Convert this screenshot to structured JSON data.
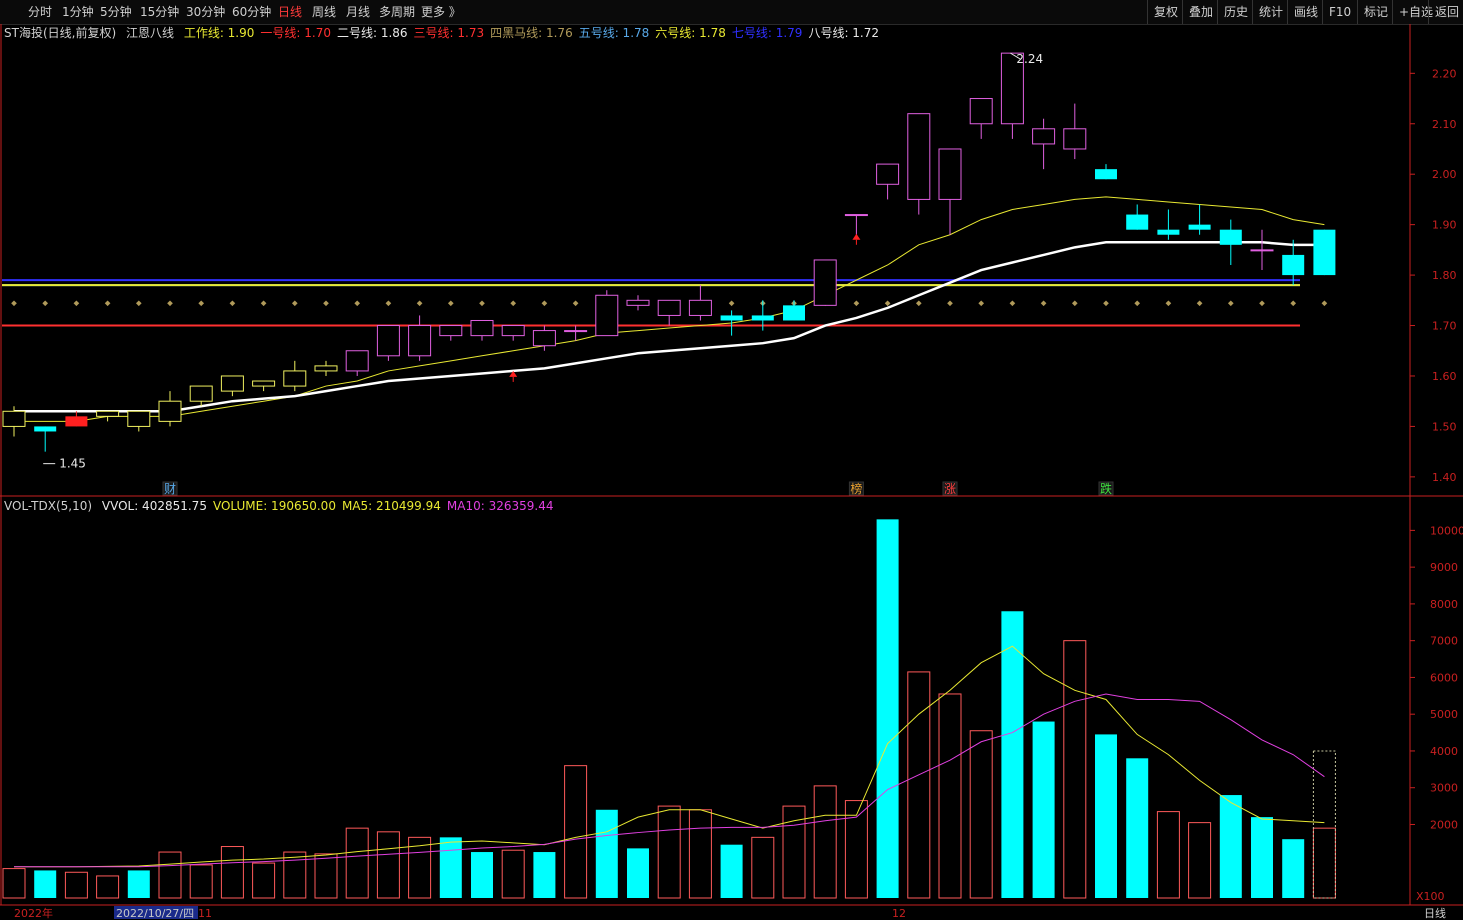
{
  "toolbar": {
    "periods": [
      "分时",
      "1分钟",
      "5分钟",
      "15分钟",
      "30分钟",
      "60分钟",
      "日线",
      "周线",
      "月线",
      "多周期",
      "更多 》"
    ],
    "active_period": "日线",
    "right_items": [
      "复权",
      "叠加",
      "历史",
      "统计",
      "画线",
      "F10",
      "标记",
      "+自选",
      "返回"
    ]
  },
  "price_legend": {
    "title": "ST海投(日线,前复权)",
    "indicator": "江恩八线",
    "lines": [
      {
        "label": "工作线: 1.90",
        "color": "#e8e832"
      },
      {
        "label": "一号线: 1.70",
        "color": "#ff3030"
      },
      {
        "label": "二号线: 1.86",
        "color": "#e8e8e8"
      },
      {
        "label": "三号线: 1.73",
        "color": "#ff3030"
      },
      {
        "label": "四黑马线: 1.76",
        "color": "#b09a5a"
      },
      {
        "label": "五号线: 1.78",
        "color": "#58a8e8"
      },
      {
        "label": "六号线: 1.78",
        "color": "#e8e832"
      },
      {
        "label": "七号线: 1.79",
        "color": "#3030ff"
      },
      {
        "label": "八号线: 1.72",
        "color": "#e8e8e8"
      }
    ]
  },
  "volume_legend": {
    "title": "VOL-TDX(5,10)",
    "items": [
      {
        "label": "VVOL: 402851.75",
        "color": "#e8e8e8"
      },
      {
        "label": "VOLUME: 190650.00",
        "color": "#e8e832"
      },
      {
        "label": "MA5: 210499.94",
        "color": "#e8e832"
      },
      {
        "label": "MA10: 326359.44",
        "color": "#e040e0"
      }
    ]
  },
  "markers": {
    "low_label": "1.45",
    "high_label": "2.24",
    "events": [
      "财",
      "榜",
      "涨",
      "跌"
    ]
  },
  "x_axis": {
    "labels": [
      "2022年",
      "2022/10/27/四",
      "11",
      "12"
    ],
    "period_label": "日线"
  },
  "volume_unit": "X100",
  "colors": {
    "up": "#ff5a5a",
    "down": "#00ffff",
    "up_candle_mid": "#e060e0",
    "up_candle_low": "#f0f060",
    "ma5": "#e8e832",
    "ma10": "#e040e0",
    "axis": "#c82020",
    "grid": "#5a0000"
  },
  "chart_data": [
    {
      "type": "candlestick",
      "title": "ST海投(日线,前复权)",
      "y_ticks": [
        1.4,
        1.5,
        1.6,
        1.7,
        1.8,
        1.9,
        2.0,
        2.1,
        2.2
      ],
      "ylim": [
        1.37,
        2.27
      ],
      "candles": [
        {
          "o": 1.5,
          "h": 1.54,
          "l": 1.48,
          "c": 1.53
        },
        {
          "o": 1.5,
          "h": 1.5,
          "l": 1.45,
          "c": 1.49
        },
        {
          "o": 1.52,
          "h": 1.53,
          "l": 1.5,
          "c": 1.5
        },
        {
          "o": 1.52,
          "h": 1.53,
          "l": 1.51,
          "c": 1.53
        },
        {
          "o": 1.5,
          "h": 1.53,
          "l": 1.49,
          "c": 1.53
        },
        {
          "o": 1.51,
          "h": 1.57,
          "l": 1.5,
          "c": 1.55
        },
        {
          "o": 1.55,
          "h": 1.58,
          "l": 1.54,
          "c": 1.58
        },
        {
          "o": 1.57,
          "h": 1.6,
          "l": 1.56,
          "c": 1.6
        },
        {
          "o": 1.58,
          "h": 1.59,
          "l": 1.57,
          "c": 1.59
        },
        {
          "o": 1.58,
          "h": 1.63,
          "l": 1.57,
          "c": 1.61
        },
        {
          "o": 1.61,
          "h": 1.63,
          "l": 1.6,
          "c": 1.62
        },
        {
          "o": 1.61,
          "h": 1.65,
          "l": 1.6,
          "c": 1.65
        },
        {
          "o": 1.64,
          "h": 1.7,
          "l": 1.63,
          "c": 1.7
        },
        {
          "o": 1.64,
          "h": 1.72,
          "l": 1.63,
          "c": 1.7
        },
        {
          "o": 1.68,
          "h": 1.7,
          "l": 1.67,
          "c": 1.7
        },
        {
          "o": 1.68,
          "h": 1.71,
          "l": 1.67,
          "c": 1.71
        },
        {
          "o": 1.68,
          "h": 1.7,
          "l": 1.67,
          "c": 1.7
        },
        {
          "o": 1.66,
          "h": 1.7,
          "l": 1.65,
          "c": 1.69
        },
        {
          "o": 1.69,
          "h": 1.7,
          "l": 1.67,
          "c": 1.69
        },
        {
          "o": 1.68,
          "h": 1.77,
          "l": 1.68,
          "c": 1.76
        },
        {
          "o": 1.74,
          "h": 1.76,
          "l": 1.73,
          "c": 1.75
        },
        {
          "o": 1.72,
          "h": 1.75,
          "l": 1.7,
          "c": 1.75
        },
        {
          "o": 1.72,
          "h": 1.78,
          "l": 1.71,
          "c": 1.75
        },
        {
          "o": 1.72,
          "h": 1.73,
          "l": 1.68,
          "c": 1.71
        },
        {
          "o": 1.72,
          "h": 1.75,
          "l": 1.69,
          "c": 1.71
        },
        {
          "o": 1.74,
          "h": 1.75,
          "l": 1.71,
          "c": 1.71
        },
        {
          "o": 1.74,
          "h": 1.83,
          "l": 1.74,
          "c": 1.83
        },
        {
          "o": 1.92,
          "h": 1.92,
          "l": 1.88,
          "c": 1.92
        },
        {
          "o": 1.98,
          "h": 2.02,
          "l": 1.95,
          "c": 2.02
        },
        {
          "o": 1.95,
          "h": 2.12,
          "l": 1.92,
          "c": 2.12
        },
        {
          "o": 1.95,
          "h": 2.05,
          "l": 1.88,
          "c": 2.05
        },
        {
          "o": 2.1,
          "h": 2.15,
          "l": 2.07,
          "c": 2.15
        },
        {
          "o": 2.1,
          "h": 2.24,
          "l": 2.07,
          "c": 2.24
        },
        {
          "o": 2.06,
          "h": 2.11,
          "l": 2.01,
          "c": 2.09
        },
        {
          "o": 2.05,
          "h": 2.14,
          "l": 2.03,
          "c": 2.09
        },
        {
          "o": 2.01,
          "h": 2.02,
          "l": 1.99,
          "c": 1.99
        },
        {
          "o": 1.92,
          "h": 1.94,
          "l": 1.89,
          "c": 1.89
        },
        {
          "o": 1.89,
          "h": 1.93,
          "l": 1.87,
          "c": 1.88
        },
        {
          "o": 1.9,
          "h": 1.94,
          "l": 1.88,
          "c": 1.89
        },
        {
          "o": 1.89,
          "h": 1.91,
          "l": 1.82,
          "c": 1.86
        },
        {
          "o": 1.85,
          "h": 1.89,
          "l": 1.81,
          "c": 1.85
        },
        {
          "o": 1.84,
          "h": 1.87,
          "l": 1.78,
          "c": 1.8
        },
        {
          "o": 1.89,
          "h": 1.89,
          "l": 1.8,
          "c": 1.8
        }
      ],
      "overlay_lines": [
        {
          "name": "七号线",
          "color": "#3030ff",
          "value": 1.79
        },
        {
          "name": "五号线",
          "color": "#58a8e8",
          "value": 1.78
        },
        {
          "name": "六号线",
          "color": "#e8e832",
          "value": 1.78
        },
        {
          "name": "四黑马线",
          "color": "#b09a5a",
          "value": 1.76
        },
        {
          "name": "一号线",
          "color": "#ff3030",
          "value": 1.7
        }
      ],
      "ma_white": [
        1.53,
        1.53,
        1.53,
        1.53,
        1.53,
        1.53,
        1.54,
        1.55,
        1.555,
        1.56,
        1.57,
        1.58,
        1.59,
        1.595,
        1.6,
        1.605,
        1.61,
        1.615,
        1.625,
        1.635,
        1.645,
        1.65,
        1.655,
        1.66,
        1.665,
        1.675,
        1.7,
        1.715,
        1.735,
        1.76,
        1.785,
        1.81,
        1.825,
        1.84,
        1.855,
        1.865,
        1.865,
        1.865,
        1.865,
        1.865,
        1.865,
        1.86,
        1.86
      ],
      "ma_yellow": [
        1.51,
        1.51,
        1.51,
        1.52,
        1.52,
        1.52,
        1.53,
        1.54,
        1.55,
        1.56,
        1.58,
        1.59,
        1.61,
        1.62,
        1.63,
        1.64,
        1.65,
        1.66,
        1.67,
        1.685,
        1.69,
        1.695,
        1.7,
        1.705,
        1.715,
        1.73,
        1.76,
        1.79,
        1.82,
        1.86,
        1.88,
        1.91,
        1.93,
        1.94,
        1.95,
        1.955,
        1.95,
        1.945,
        1.94,
        1.935,
        1.93,
        1.91,
        1.9
      ]
    },
    {
      "type": "bar",
      "title": "VOL-TDX(5,10)",
      "y_ticks": [
        2000,
        3000,
        4000,
        5000,
        6000,
        7000,
        8000,
        9000,
        10000
      ],
      "ylim": [
        0,
        10500
      ],
      "values": [
        800,
        750,
        700,
        600,
        750,
        1250,
        900,
        1400,
        950,
        1250,
        1200,
        1900,
        1800,
        1650,
        1650,
        1250,
        1300,
        1250,
        3600,
        2400,
        1350,
        2500,
        2400,
        1450,
        1650,
        2500,
        3050,
        2650,
        10300,
        6150,
        5550,
        4550,
        7800,
        4800,
        7000,
        4450,
        3800,
        2350,
        2050,
        2800,
        2200,
        1600,
        1900
      ],
      "up": [
        true,
        false,
        true,
        true,
        false,
        true,
        true,
        true,
        true,
        true,
        true,
        true,
        true,
        true,
        false,
        false,
        true,
        false,
        true,
        false,
        false,
        true,
        true,
        false,
        true,
        true,
        true,
        true,
        false,
        true,
        true,
        true,
        false,
        false,
        true,
        false,
        false,
        true,
        true,
        false,
        false,
        false,
        true
      ],
      "ma5": [
        850,
        850,
        850,
        860,
        870,
        920,
        980,
        1030,
        1060,
        1110,
        1170,
        1260,
        1340,
        1420,
        1520,
        1550,
        1500,
        1450,
        1650,
        1800,
        2200,
        2400,
        2400,
        2150,
        1900,
        2100,
        2250,
        2250,
        4200,
        5000,
        5650,
        6400,
        6850,
        6100,
        5650,
        5400,
        4450,
        3900,
        3200,
        2600,
        2150,
        2100,
        2050
      ],
      "ma10": [
        850,
        850,
        850,
        850,
        850,
        880,
        920,
        960,
        990,
        1030,
        1080,
        1140,
        1190,
        1240,
        1300,
        1360,
        1400,
        1460,
        1600,
        1700,
        1780,
        1850,
        1900,
        1920,
        1920,
        1980,
        2100,
        2200,
        2950,
        3350,
        3750,
        4250,
        4500,
        5000,
        5350,
        5550,
        5400,
        5400,
        5350,
        4850,
        4300,
        3900,
        3300
      ],
      "vvol": 4000
    }
  ]
}
